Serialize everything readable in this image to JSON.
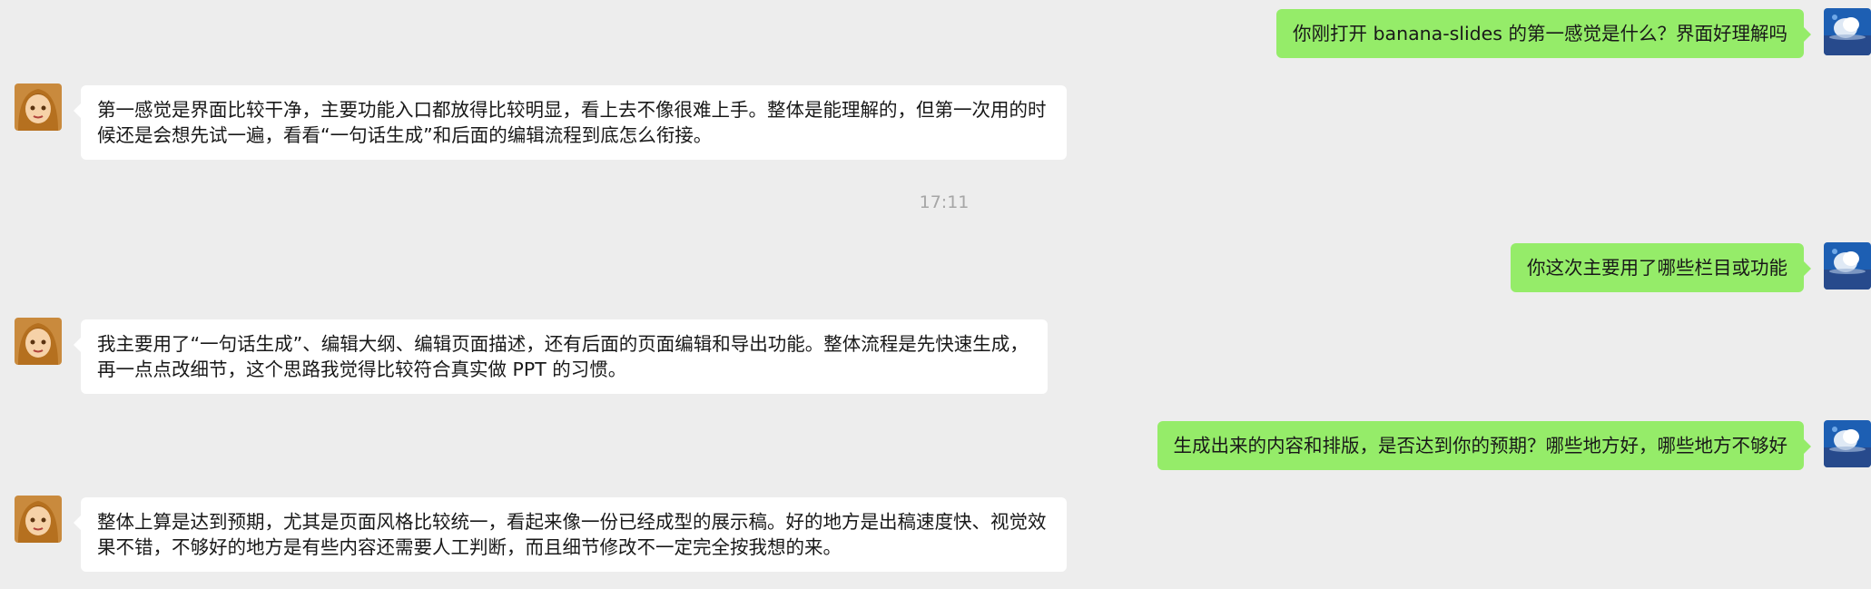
{
  "colors": {
    "background": "#ededed",
    "self_bubble": "#95ec69",
    "other_bubble": "#ffffff"
  },
  "messages": [
    {
      "sender": "self",
      "text": "你刚打开 banana-slides 的第一感觉是什么？界面好理解吗"
    },
    {
      "sender": "other",
      "text": "第一感觉是界面比较干净，主要功能入口都放得比较明显，看上去不像很难上手。整体是能理解的，但第一次用的时候还是会想先试一遍，看看“一句话生成”和后面的编辑流程到底怎么衔接。"
    },
    {
      "type": "timestamp",
      "text": "17:11"
    },
    {
      "sender": "self",
      "text": "你这次主要用了哪些栏目或功能"
    },
    {
      "sender": "other",
      "text": "我主要用了“一句话生成”、编辑大纲、编辑页面描述，还有后面的页面编辑和导出功能。整体流程是先快速生成，再一点点改细节，这个思路我觉得比较符合真实做 PPT 的习惯。"
    },
    {
      "sender": "self",
      "text": "生成出来的内容和排版，是否达到你的预期？哪些地方好，哪些地方不够好"
    },
    {
      "sender": "other",
      "text": "整体上算是达到预期，尤其是页面风格比较统一，看起来像一份已经成型的展示稿。好的地方是出稿速度快、视觉效果不错，不够好的地方是有些内容还需要人工判断，而且细节修改不一定完全按我想的来。"
    }
  ]
}
